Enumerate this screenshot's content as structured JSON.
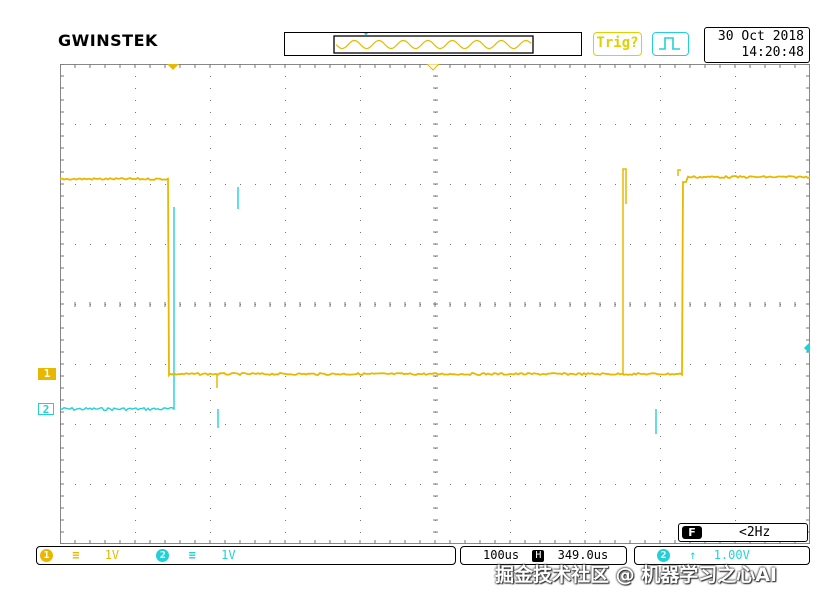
{
  "brand": {
    "logo_text": "GWINSTEK"
  },
  "status": {
    "trigger_label": "Trig?",
    "date": "30 Oct 2018",
    "time": "14:20:48"
  },
  "channels": {
    "ch1": {
      "marker": "1",
      "number": "1",
      "coupling_icon": "dc-coupling-icon",
      "scale": "1V",
      "color": "#e8b800"
    },
    "ch2": {
      "marker": "2",
      "number": "2",
      "coupling_icon": "dc-coupling-icon",
      "scale": "1V",
      "color": "#22d0d8"
    }
  },
  "timebase": {
    "scale": "100us",
    "position_icon": "horizontal-position-icon",
    "position": "349.0us"
  },
  "trigger": {
    "source": "2",
    "slope_icon": "rising-edge-icon",
    "level": "1.00V"
  },
  "frequency": {
    "badge": "F",
    "value": "<2Hz"
  },
  "watermark": "掘金技术社区 @ 机器学习之心AI"
}
